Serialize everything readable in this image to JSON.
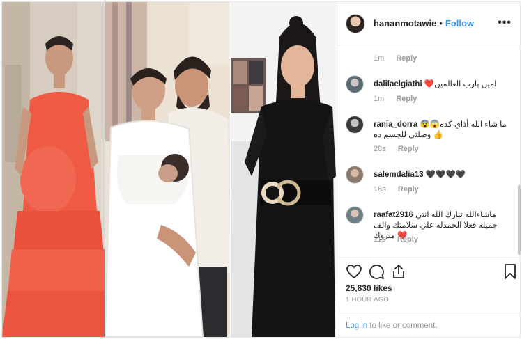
{
  "header": {
    "username": "hananmotawie",
    "separator": "•",
    "follow_label": "Follow",
    "more_icon": "•••"
  },
  "top_meta": {
    "time": "1m",
    "reply": "Reply"
  },
  "comments": [
    {
      "user": "dalilaelgiathi",
      "text": "❤️امين يارب العالمين",
      "time": "1m",
      "reply": "Reply"
    },
    {
      "user": "rania_dorra",
      "text": "ما شاء الله أذاي كده😱😨 👍 وصلتي للجسم ده",
      "time": "28s",
      "reply": "Reply"
    },
    {
      "user": "salemdalia13",
      "text": "🖤🖤🖤🖤",
      "time": "18s",
      "reply": "Reply"
    },
    {
      "user": "raafat2916",
      "text": "ماشاءالله تبارك الله انتي جميله فعلا الحمدله علي سلامتك والف مبروك ❤️",
      "time": "11s",
      "reply": "Reply"
    }
  ],
  "actions": {
    "likes": "25,830 likes",
    "time_ago": "1 HOUR AGO",
    "login_link": "Log in",
    "login_text": "to like or comment."
  },
  "colors": {
    "accent": "#3897f0",
    "muted": "#999999",
    "text": "#262626",
    "border": "#efefef"
  }
}
